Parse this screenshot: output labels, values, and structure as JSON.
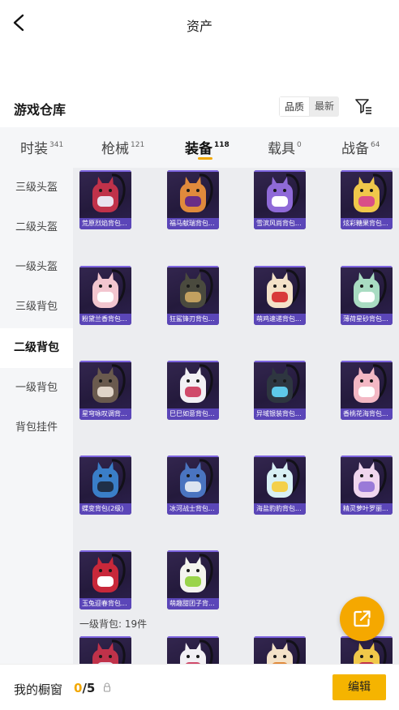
{
  "header": {
    "title": "资产",
    "back_icon": "chevron-left-icon"
  },
  "warehouse": {
    "title": "游戏仓库",
    "sort_options": [
      "品质",
      "最新"
    ],
    "filter_icon": "filter-list-icon"
  },
  "tabs": [
    {
      "label": "时装",
      "count": "341",
      "active": false
    },
    {
      "label": "枪械",
      "count": "121",
      "active": false
    },
    {
      "label": "装备",
      "count": "118",
      "active": true
    },
    {
      "label": "载具",
      "count": "0",
      "active": false
    },
    {
      "label": "战备",
      "count": "64",
      "active": false
    }
  ],
  "sidebar": {
    "items": [
      {
        "label": "三级头盔",
        "active": false
      },
      {
        "label": "二级头盔",
        "active": false
      },
      {
        "label": "一级头盔",
        "active": false
      },
      {
        "label": "三级背包",
        "active": false
      },
      {
        "label": "二级背包",
        "active": true
      },
      {
        "label": "一级背包",
        "active": false
      },
      {
        "label": "背包挂件",
        "active": false
      }
    ]
  },
  "items": [
    {
      "name": "荒原烈焰背包...",
      "color": "#c0324a",
      "accent": "#e9e3ef"
    },
    {
      "name": "福马献瑞背包...",
      "color": "#e08a3c",
      "accent": "#6a2d86"
    },
    {
      "name": "雪滨风尚背包...",
      "color": "#8f6ad8",
      "accent": "#ffffff"
    },
    {
      "name": "炫彩糖果背包...",
      "color": "#f0c84a",
      "accent": "#d94f88"
    },
    {
      "name": "粉黛兰香背包...",
      "color": "#f2c6cf",
      "accent": "#ffffff"
    },
    {
      "name": "狂鲨锋刃背包...",
      "color": "#4a4a3e",
      "accent": "#c2a060"
    },
    {
      "name": "萌鸡速递背包...",
      "color": "#f4e2c8",
      "accent": "#d83a3a"
    },
    {
      "name": "薄荷星砂背包...",
      "color": "#a9dcc2",
      "accent": "#ffffff"
    },
    {
      "name": "星穹咏叹调背...",
      "color": "#6a5a4e",
      "accent": "#e0d4c8"
    },
    {
      "name": "巳巳如意背包...",
      "color": "#f2f0f4",
      "accent": "#d04a6a"
    },
    {
      "name": "异域银装背包...",
      "color": "#2e3640",
      "accent": "#5ec8e8"
    },
    {
      "name": "香桃花海背包...",
      "color": "#f3b8c4",
      "accent": "#ffffff"
    },
    {
      "name": "蝶变背包(2级)",
      "color": "#3a7ec8",
      "accent": "#1f2f48"
    },
    {
      "name": "冰河战士背包...",
      "color": "#4a74c0",
      "accent": "#dce4f0"
    },
    {
      "name": "海盐豹豹背包...",
      "color": "#d8f0f4",
      "accent": "#f4d04a"
    },
    {
      "name": "精灵萝叶罗丽...",
      "color": "#f0d6ee",
      "accent": "#9a7ad8"
    },
    {
      "name": "玉兔迎春背包...",
      "color": "#c8283a",
      "accent": "#ffffff"
    },
    {
      "name": "萌趣甜团子背...",
      "color": "#f4f4ee",
      "accent": "#9ad44a"
    }
  ],
  "next_section": {
    "label": "一级背包: 19件",
    "preview": [
      {
        "color": "#c0324a",
        "accent": "#e9e3ef"
      },
      {
        "color": "#f2f0f4",
        "accent": "#d04a6a"
      },
      {
        "color": "#f4e2c8",
        "accent": "#e08a3c"
      },
      {
        "color": "#f0c84a",
        "accent": "#c0324a"
      }
    ]
  },
  "fab_icon": "share-external-icon",
  "footer": {
    "showcase_label": "我的橱窗",
    "showcase_current": "0",
    "showcase_total": "/5",
    "lock_icon": "lock-icon",
    "edit_label": "编辑"
  },
  "colors": {
    "accent": "#f2a800",
    "tab_bg": "#f5f6f8",
    "card_label_bg": "#5b46b8"
  }
}
